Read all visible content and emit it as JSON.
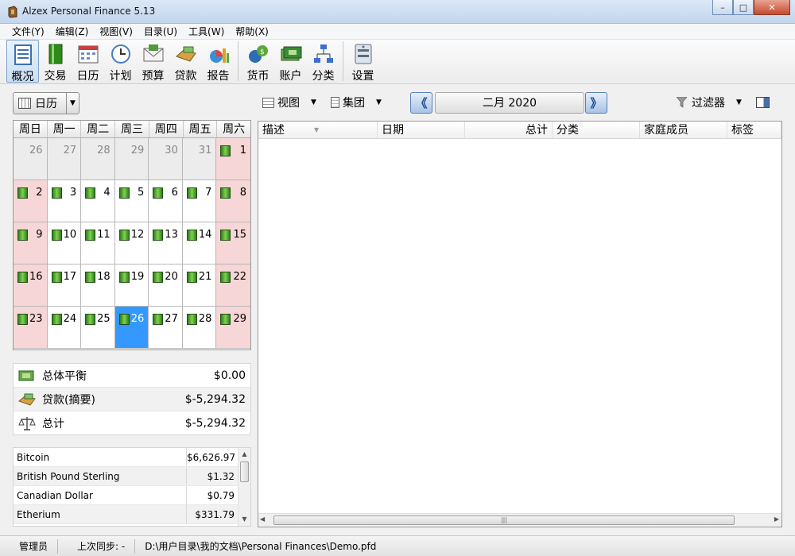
{
  "window": {
    "title": "Alzex Personal Finance 5.13",
    "close_glyph": "✕",
    "minimize_glyph": "–",
    "maximize_glyph": "□"
  },
  "menu": [
    "文件(Y)",
    "编辑(Z)",
    "视图(V)",
    "目录(U)",
    "工具(W)",
    "帮助(X)"
  ],
  "toolbar": {
    "items": [
      {
        "label": "概况",
        "icon": "overview-icon",
        "color": "#3b6fb6",
        "active": true
      },
      {
        "label": "交易",
        "icon": "book-icon",
        "color": "#2f8a1d"
      },
      {
        "label": "日历",
        "icon": "calendar-icon",
        "color": "#c84040"
      },
      {
        "label": "计划",
        "icon": "clock-icon",
        "color": "#4a7bbf"
      },
      {
        "label": "预算",
        "icon": "envelope-icon",
        "color": "#4f9a3b"
      },
      {
        "label": "贷款",
        "icon": "loan-icon",
        "color": "#d8a043"
      },
      {
        "label": "报告",
        "icon": "chart-icon",
        "color": "#e0a020"
      },
      {
        "label": "货币",
        "icon": "currency-icon",
        "color": "#2d6bb5"
      },
      {
        "label": "账户",
        "icon": "accounts-icon",
        "color": "#3a8a3a"
      },
      {
        "label": "分类",
        "icon": "categories-icon",
        "color": "#3a6fd0"
      },
      {
        "label": "设置",
        "icon": "settings-icon",
        "color": "#5b6b80"
      }
    ]
  },
  "calendar": {
    "dropdown_label": "日历",
    "weekdays": [
      "周日",
      "周一",
      "周二",
      "周三",
      "周四",
      "周五",
      "周六"
    ],
    "days": [
      {
        "n": "26",
        "t": "other"
      },
      {
        "n": "27",
        "t": "other"
      },
      {
        "n": "28",
        "t": "other"
      },
      {
        "n": "29",
        "t": "other"
      },
      {
        "n": "30",
        "t": "other"
      },
      {
        "n": "31",
        "t": "other"
      },
      {
        "n": "1",
        "t": "weekend",
        "b": true
      },
      {
        "n": "2",
        "t": "weekend",
        "b": true
      },
      {
        "n": "3",
        "b": true
      },
      {
        "n": "4",
        "b": true
      },
      {
        "n": "5",
        "b": true
      },
      {
        "n": "6",
        "b": true
      },
      {
        "n": "7",
        "b": true
      },
      {
        "n": "8",
        "t": "weekend",
        "b": true
      },
      {
        "n": "9",
        "t": "weekend",
        "b": true
      },
      {
        "n": "10",
        "b": true
      },
      {
        "n": "11",
        "b": true
      },
      {
        "n": "12",
        "b": true
      },
      {
        "n": "13",
        "b": true
      },
      {
        "n": "14",
        "b": true
      },
      {
        "n": "15",
        "t": "weekend",
        "b": true
      },
      {
        "n": "16",
        "t": "weekend",
        "b": true
      },
      {
        "n": "17",
        "b": true
      },
      {
        "n": "18",
        "b": true
      },
      {
        "n": "19",
        "b": true
      },
      {
        "n": "20",
        "b": true
      },
      {
        "n": "21",
        "b": true
      },
      {
        "n": "22",
        "t": "weekend",
        "b": true
      },
      {
        "n": "23",
        "t": "weekend",
        "b": true
      },
      {
        "n": "24",
        "b": true
      },
      {
        "n": "25",
        "b": true
      },
      {
        "n": "26",
        "t": "today",
        "b": true
      },
      {
        "n": "27",
        "b": true
      },
      {
        "n": "28",
        "b": true
      },
      {
        "n": "29",
        "t": "weekend",
        "b": true
      }
    ]
  },
  "summary": [
    {
      "label": "总体平衡",
      "value": "$0.00",
      "icon": "balance-icon"
    },
    {
      "label": "贷款(摘要)",
      "value": "$-5,294.32",
      "icon": "loan-icon"
    },
    {
      "label": "总计",
      "value": "$-5,294.32",
      "icon": "scales-icon"
    }
  ],
  "currencies": [
    {
      "name": "Bitcoin",
      "value": "$6,626.97"
    },
    {
      "name": "British Pound Sterling",
      "value": "$1.32"
    },
    {
      "name": "Canadian Dollar",
      "value": "$0.79"
    },
    {
      "name": "Etherium",
      "value": "$331.79"
    }
  ],
  "controls": {
    "view_label": "视图",
    "group_label": "集团",
    "period": "二月 2020",
    "filter_label": "过滤器",
    "prev_glyph": "《",
    "next_glyph": "》"
  },
  "grid": {
    "columns": [
      {
        "label": "描述",
        "width": 150,
        "sort": true
      },
      {
        "label": "日期",
        "width": 110
      },
      {
        "label": "总计",
        "width": 110,
        "align": "right"
      },
      {
        "label": "分类",
        "width": 110
      },
      {
        "label": "家庭成员",
        "width": 110
      },
      {
        "label": "标签",
        "width": 68
      }
    ],
    "rows": []
  },
  "status": {
    "user": "管理员",
    "last_sync": "上次同步: -",
    "path": "D:\\用户目录\\我的文档\\Personal Finances\\Demo.pfd"
  }
}
